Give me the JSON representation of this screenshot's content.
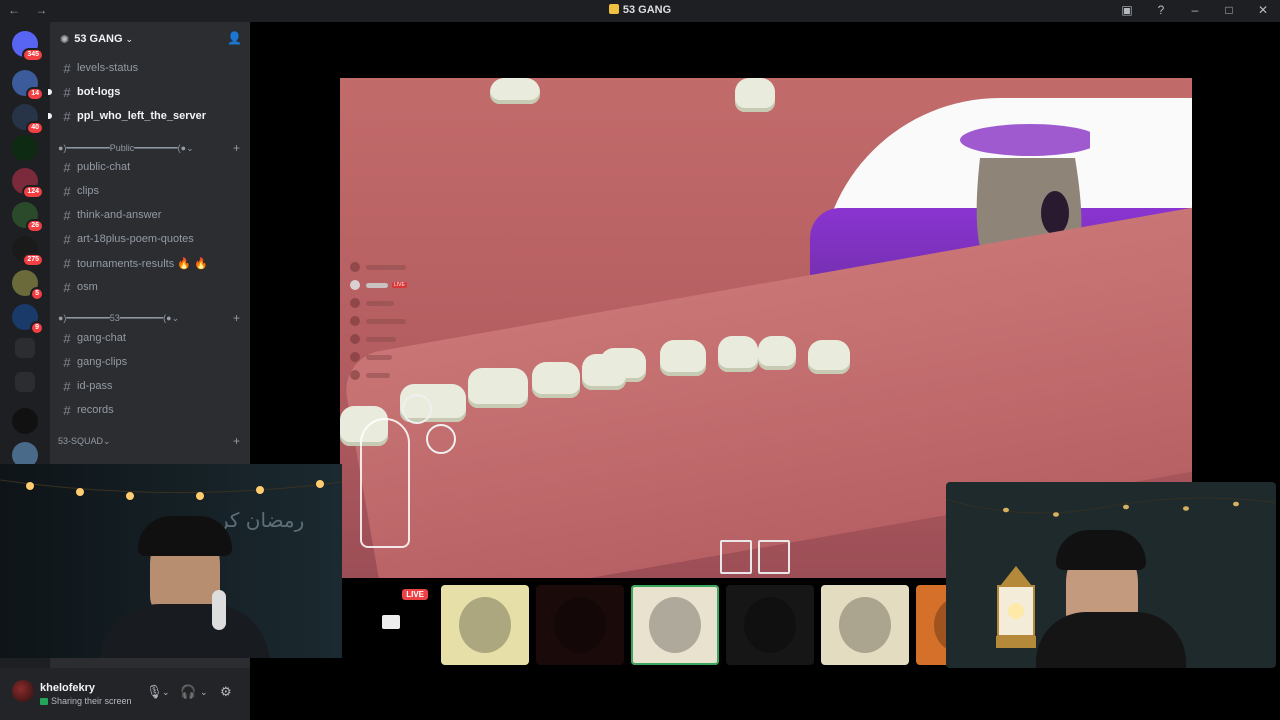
{
  "window": {
    "title": "53 GANG",
    "nav_icons": "←  →",
    "controls": [
      "inbox-icon",
      "help-icon",
      "minimize-icon",
      "maximize-icon",
      "close-icon"
    ]
  },
  "guilds": [
    {
      "name": "discord-home",
      "badge": "345",
      "color": "#5865f2"
    },
    {
      "name": "server-2",
      "badge": "14",
      "color": "#3b5b9a"
    },
    {
      "name": "server-3",
      "badge": "40",
      "color": "#273447"
    },
    {
      "name": "53-gang",
      "badge": "",
      "color": "#0e2a12"
    },
    {
      "name": "server-5",
      "badge": "124",
      "color": "#7a2a3a"
    },
    {
      "name": "server-6",
      "badge": "26",
      "color": "#2b4a2b"
    },
    {
      "name": "server-7",
      "badge": "275",
      "color": "#1a1a1a"
    },
    {
      "name": "server-8",
      "badge": "5",
      "color": "#6a6a3a"
    },
    {
      "name": "server-9",
      "badge": "9",
      "color": "#1a3a6a"
    },
    {
      "name": "folder",
      "badge": "",
      "color": "#2b2d31"
    },
    {
      "name": "more",
      "badge": "",
      "color": "#2b2d31"
    },
    {
      "name": "server-kick",
      "badge": "",
      "color": "#111"
    },
    {
      "name": "server-13",
      "badge": "",
      "color": "#4a6a8a"
    }
  ],
  "server": {
    "name": "53 GANG"
  },
  "channels_top": [
    {
      "label": "levels-status",
      "unread": false
    },
    {
      "label": "bot-logs",
      "unread": true
    },
    {
      "label": "ppl_who_left_the_server",
      "unread": true
    }
  ],
  "categories": {
    "public": "●)━━━━━━━━Public━━━━━━━━(●",
    "fifty_three": "●)━━━━━━━━53━━━━━━━━(●",
    "squad": "53-SQUAD"
  },
  "channels_public": [
    {
      "label": "public-chat"
    },
    {
      "label": "clips"
    },
    {
      "label": "think-and-answer"
    },
    {
      "label": "art-18plus-poem-quotes"
    },
    {
      "label": "tournaments-results 🔥 🔥"
    },
    {
      "label": "osm"
    }
  ],
  "channels_53": [
    {
      "label": "gang-chat"
    },
    {
      "label": "gang-clips"
    },
    {
      "label": "id-pass"
    },
    {
      "label": "records"
    }
  ],
  "user": {
    "name": "khelofekry",
    "status": "Sharing their screen"
  },
  "stream_strip": {
    "live_label": "LIVE",
    "tiles": [
      {
        "name": "screen-share-tile",
        "color": "#000000"
      },
      {
        "name": "participant-1",
        "color": "#e6dfa8"
      },
      {
        "name": "participant-2",
        "color": "#1a0a0a"
      },
      {
        "name": "participant-3",
        "color": "#e9e2cf"
      },
      {
        "name": "participant-4",
        "color": "#161616"
      },
      {
        "name": "participant-5",
        "color": "#e4dcc0"
      },
      {
        "name": "participant-6",
        "color": "#d4702a"
      }
    ]
  },
  "webcam_left": {
    "overlay_text": "رمضان كريم"
  }
}
